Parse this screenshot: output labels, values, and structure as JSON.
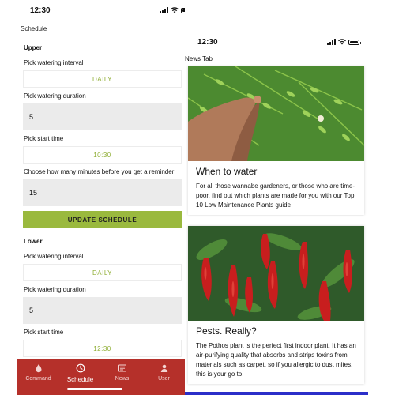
{
  "left_screen": {
    "status_time": "12:30",
    "screen_title": "Schedule",
    "sections": [
      {
        "title": "Upper",
        "interval_label": "Pick watering interval",
        "interval_value": "DAILY",
        "duration_label": "Pick watering duration",
        "duration_value": "5",
        "start_label": "Pick start time",
        "start_value": "10:30",
        "reminder_label": "Choose how many minutes before you get a reminder",
        "reminder_value": "15",
        "update_button": "UPDATE SCHEDULE"
      },
      {
        "title": "Lower",
        "interval_label": "Pick watering interval",
        "interval_value": "DAILY",
        "duration_label": "Pick watering duration",
        "duration_value": "5",
        "start_label": "Pick start time",
        "start_value": "12:30"
      }
    ],
    "tabs": [
      {
        "label": "Command",
        "icon": "water-drop-icon"
      },
      {
        "label": "Schedule",
        "icon": "clock-icon",
        "active": true
      },
      {
        "label": "News",
        "icon": "news-icon"
      },
      {
        "label": "User",
        "icon": "user-icon"
      }
    ],
    "tab_bar_color": "#b5302a",
    "accent_color": "#9ab93e"
  },
  "right_screen": {
    "status_time": "12:30",
    "screen_title": "News Tab",
    "articles": [
      {
        "title": "When to water",
        "body": "For all those wannabe gardeners, or those who are time-poor, find out which plants are made for you with our Top 10 Low Maintenance Plants guide",
        "image": "hand-touching-fern-photo"
      },
      {
        "title": "Pests. Really?",
        "body": "The Pothos plant is the perfect first indoor plant. It has an air-purifying quality that absorbs and strips toxins from materials such as carpet, so if you allergic to dust mites, this is your go to!",
        "image": "red-chili-peppers-photo"
      }
    ]
  }
}
